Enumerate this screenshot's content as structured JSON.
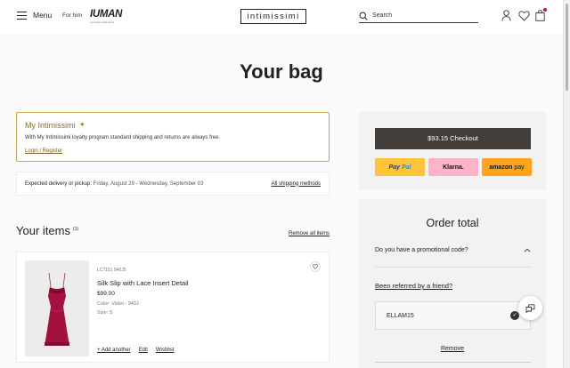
{
  "header": {
    "menu_label": "Menu",
    "for_him": "For him",
    "iuman_logo": "IUMAN",
    "iuman_tagline": "nel rispetto della natura",
    "logo": "intimissimi",
    "search_placeholder": "Search"
  },
  "page": {
    "title": "Your bag"
  },
  "loyalty": {
    "title": "My Intimissimi",
    "text": "With My Intimissimi loyalty program standard shipping and returns are always free.",
    "link": "Login / Register"
  },
  "delivery": {
    "label": "Expected delivery or pickup:",
    "dates": "Friday, August 29 - Wednesday, September 03",
    "link": "All shipping methods"
  },
  "items": {
    "title": "Your items",
    "count": "(1)",
    "remove_all": "Remove all items",
    "list": [
      {
        "sku": "LC7151 940J5",
        "name": "Silk Slip with Lace Insert Detail",
        "price": "$99.00",
        "color": "Color: Violet - 940J",
        "size": "Size: S",
        "add_another": "+ Add another",
        "edit": "Edit",
        "wishlist": "Wishlist",
        "product_color_hex": "#a3123f"
      }
    ]
  },
  "checkout": {
    "button": "$93.15 Checkout",
    "paypal_1": "Pay",
    "paypal_2": "Pal",
    "klarna": "Klarna.",
    "amazon_1": "amazon",
    "amazon_2": "pay"
  },
  "order": {
    "title": "Order total",
    "promo_question": "Do you have a promotional code?",
    "referred": "Been referred by a friend?",
    "code_value": "ELLAM15",
    "remove": "Remove"
  },
  "colors": {
    "gold_accent": "#c9a85a",
    "checkout_dark": "#433d39",
    "paypal_yellow": "#ffc43a",
    "klarna_pink": "#ffb3c7",
    "amazon_orange": "#ffa41c"
  }
}
